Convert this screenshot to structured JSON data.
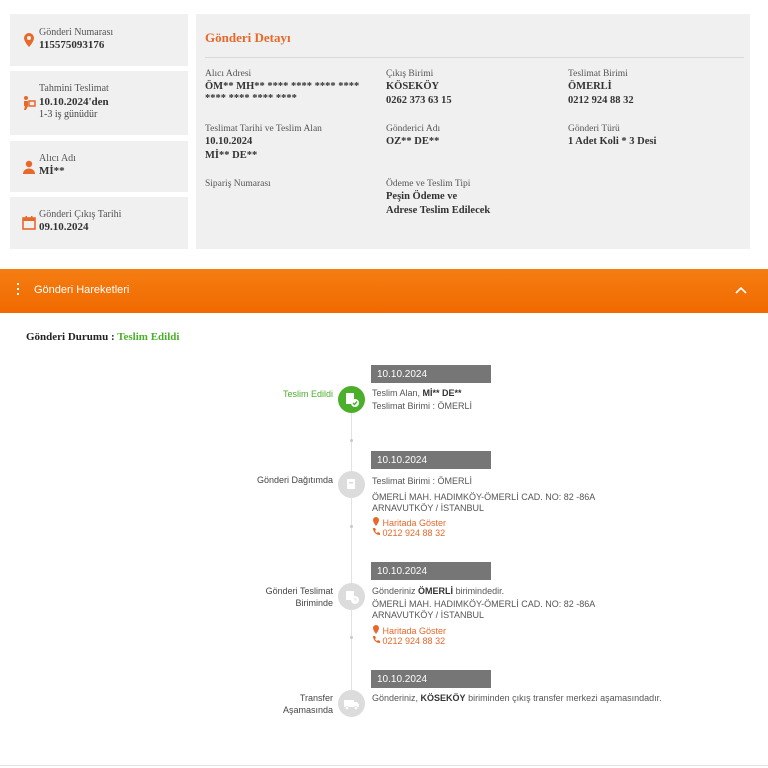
{
  "cards": {
    "tracking": {
      "label": "Gönderi Numarası",
      "value": "115575093176"
    },
    "estimated": {
      "label": "Tahmini Teslimat",
      "value": "10.10.2024'den",
      "sub": "1-3 iş günüdür"
    },
    "recipient": {
      "label": "Alıcı Adı",
      "value": "Mİ**"
    },
    "ship_date": {
      "label": "Gönderi Çıkış Tarihi",
      "value": "09.10.2024"
    }
  },
  "detail": {
    "title": "Gönderi Detayı",
    "receiver_address": {
      "label": "Alıcı Adresi",
      "value": "ÖM** MH** **** **** **** **** **** **** **** ****"
    },
    "origin_unit": {
      "label": "Çıkış Birimi",
      "value": "KÖSEKÖY",
      "phone": "0262 373 63 15"
    },
    "delivery_unit": {
      "label": "Teslimat Birimi",
      "value": "ÖMERLİ",
      "phone": "0212 924 88 32"
    },
    "delivery_date": {
      "label": "Teslimat Tarihi ve Teslim Alan",
      "value": "10.10.2024",
      "receiver": "Mİ** DE**"
    },
    "sender": {
      "label": "Gönderici Adı",
      "value": "OZ** DE**"
    },
    "type": {
      "label": "Gönderi Türü",
      "value": "1 Adet Koli * 3 Desi"
    },
    "order_no": {
      "label": "Sipariş Numarası",
      "value": ""
    },
    "payment": {
      "label": "Ödeme ve Teslim Tipi",
      "value1": "Peşin Ödeme ve",
      "value2": "Adrese Teslim Edilecek"
    }
  },
  "movements": {
    "title": "Gönderi Hareketleri",
    "status_label": "Gönderi Durumu :",
    "status_value": "Teslim Edildi",
    "steps": [
      {
        "date": "10.10.2024",
        "label": "Teslim Edildi",
        "line1": "Teslim Alan,",
        "line1_bold": "Mİ** DE**",
        "line2": "Teslimat Birimi : ÖMERLİ"
      },
      {
        "date": "10.10.2024",
        "label": "Gönderi Dağıtımda",
        "line1": "Teslimat Birimi : ÖMERLİ",
        "line2": "ÖMERLİ MAH. HADIMKÖY-ÖMERLİ CAD. NO: 82 -86A",
        "line3": "ARNAVUTKÖY / İSTANBUL",
        "map": "Haritada Göster",
        "phone": "0212 924 88 32"
      },
      {
        "date": "10.10.2024",
        "label1": "Gönderi Teslimat",
        "label2": "Biriminde",
        "line1_pre": "Gönderiniz",
        "line1_bold": "ÖMERLİ",
        "line1_post": "birimindedir.",
        "line2": "ÖMERLİ MAH. HADIMKÖY-ÖMERLİ CAD. NO: 82 -86A",
        "line3": "ARNAVUTKÖY / İSTANBUL",
        "map": "Haritada Göster",
        "phone": "0212 924 88 32"
      },
      {
        "date": "10.10.2024",
        "label1": "Transfer",
        "label2": "Aşamasında",
        "line1_pre": "Gönderiniz,",
        "line1_bold": "KÖSEKÖY",
        "line1_post": "biriminden çıkış transfer merkezi aşamasındadır."
      }
    ]
  },
  "colors": {
    "accent": "#e8682a",
    "bar": "#f57d12",
    "success": "#4caf2c",
    "date_box": "#767676"
  }
}
